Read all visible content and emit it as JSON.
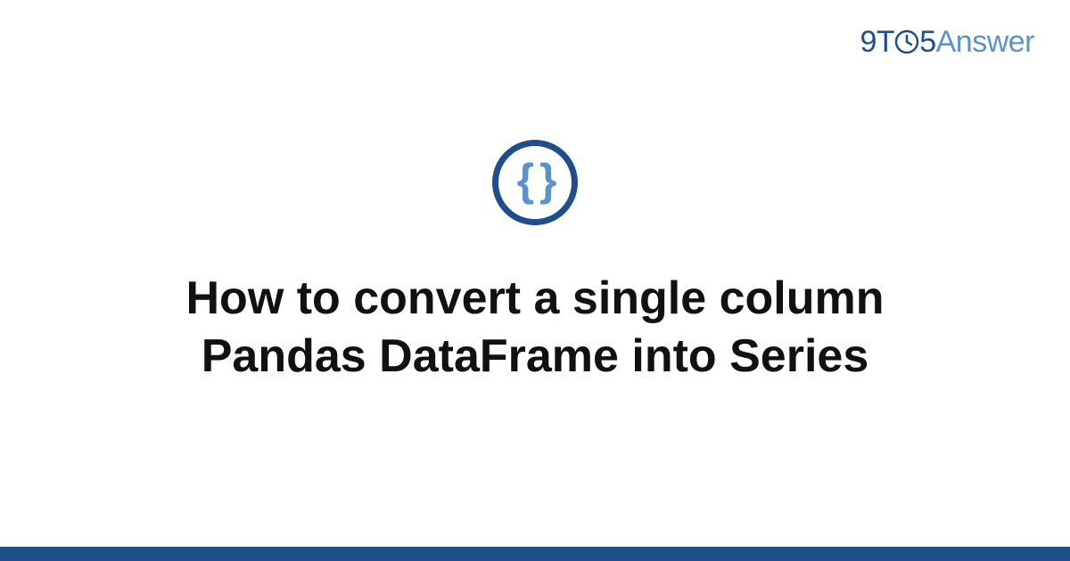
{
  "brand": {
    "part1": "9",
    "part2": "T",
    "part3": "5",
    "part4": "Answer"
  },
  "icon": {
    "glyph": "{ }",
    "name": "code-braces-icon"
  },
  "title": "How to convert a single column Pandas DataFrame into Series",
  "colors": {
    "primary": "#1e4f8a",
    "accent": "#5a93cc"
  }
}
